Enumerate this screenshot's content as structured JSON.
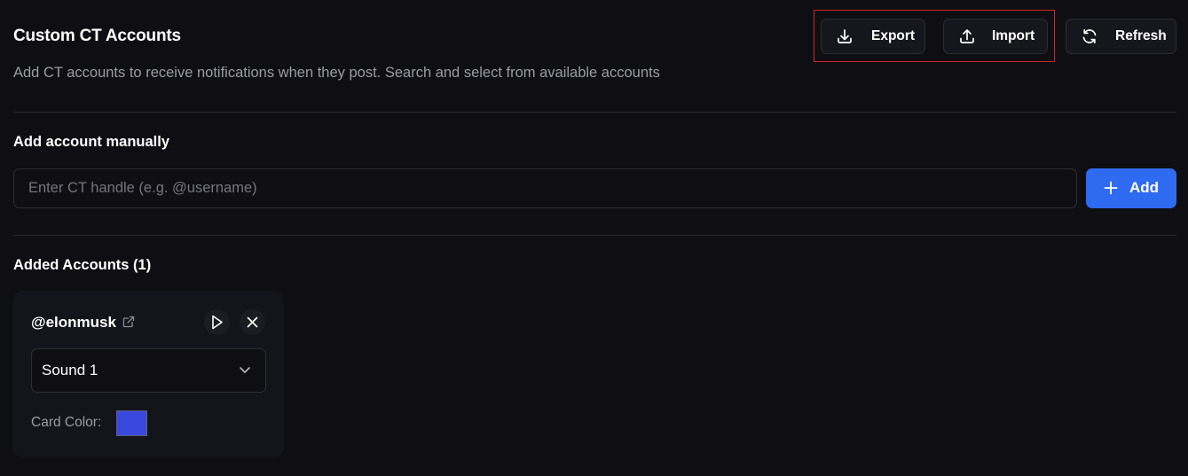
{
  "header": {
    "title": "Custom CT Accounts",
    "subtitle": "Add CT accounts to receive notifications when they post. Search and select from available accounts"
  },
  "toolbar": {
    "export_label": "Export",
    "import_label": "Import",
    "refresh_label": "Refresh",
    "export_icon": "download-icon",
    "import_icon": "upload-icon",
    "refresh_icon": "refresh-icon"
  },
  "manual_add": {
    "title": "Add account manually",
    "input_placeholder": "Enter CT handle (e.g. @username)",
    "input_value": "",
    "add_label": "Add",
    "add_icon": "plus-icon"
  },
  "added_accounts": {
    "title": "Added Accounts (1)",
    "items": [
      {
        "handle": "@elonmusk",
        "sound": "Sound 1",
        "card_color_label": "Card Color:",
        "card_color": "#3b48e0"
      }
    ]
  },
  "colors": {
    "background": "#0f0f13",
    "accent": "#2f6bf1",
    "highlight_border": "#d4242a",
    "muted_text": "#9a9ba3"
  }
}
